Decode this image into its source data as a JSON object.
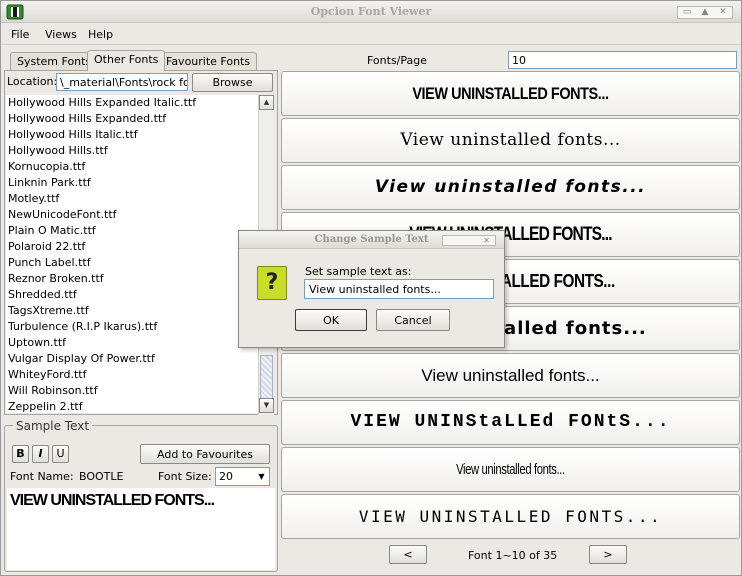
{
  "window": {
    "title": "Opcion Font Viewer",
    "controls": [
      "▭",
      "▲",
      "✕"
    ]
  },
  "menu": [
    {
      "label": "File"
    },
    {
      "label": "Views"
    },
    {
      "label": "Help"
    }
  ],
  "tabs": [
    {
      "label": "System Fonts"
    },
    {
      "label": "Other Fonts"
    },
    {
      "label": "Favourite Fonts"
    }
  ],
  "location": {
    "label": "Location:",
    "value": "\\_material\\Fonts\\rock font",
    "browse_label": "Browse"
  },
  "files": [
    "Hollywood Hills Expanded Italic.ttf",
    "Hollywood Hills Expanded.ttf",
    "Hollywood Hills Italic.ttf",
    "Hollywood Hills.ttf",
    "Kornucopia.ttf",
    "Linknin Park.ttf",
    "Motley.ttf",
    "NewUnicodeFont.ttf",
    "Plain O Matic.ttf",
    "Polaroid 22.ttf",
    "Punch Label.ttf",
    "Reznor Broken.ttf",
    "Shredded.ttf",
    "TagsXtreme.ttf",
    "Turbulence  (R.I.P Ikarus).ttf",
    "Uptown.ttf",
    "Vulgar Display Of Power.ttf",
    "WhiteyFord.ttf",
    "Will Robinson.ttf",
    "Zeppelin 2.ttf"
  ],
  "sample": {
    "legend": "Sample Text",
    "bold_label": "B",
    "italic_label": "I",
    "underline_label": "U",
    "add_favourites_label": "Add to Favourites",
    "font_name_label": "Font Name:",
    "font_name": "BOOTLE",
    "font_size_label": "Font Size:",
    "font_size": "20",
    "preview_text": "VIEW UNINSTALLED FONTS..."
  },
  "right": {
    "fonts_per_page_label": "Fonts/Page",
    "fonts_per_page": "10",
    "previews": [
      "VIEW UNINSTALLED FONTS...",
      "View uninstalled fonts...",
      "View uninstalled fonts...",
      "VIEW UNINSTALLED FONTS...",
      "VIEW UNINSTALLED FONTS...",
      "View uninstalled fonts...",
      "View uninstalled fonts...",
      "VIEW UNINStaLLEd FONtS...",
      "View uninstalled fonts...",
      "VIEW UNINSTALLED FONTS..."
    ],
    "prev_label": "<",
    "next_label": ">",
    "pager_text": "Font 1~10 of 35"
  },
  "dialog": {
    "title": "Change Sample Text",
    "close_glyph": "✕",
    "icon_glyph": "?",
    "label": "Set sample text as:",
    "value": "View uninstalled fonts...",
    "ok_label": "OK",
    "cancel_label": "Cancel"
  }
}
